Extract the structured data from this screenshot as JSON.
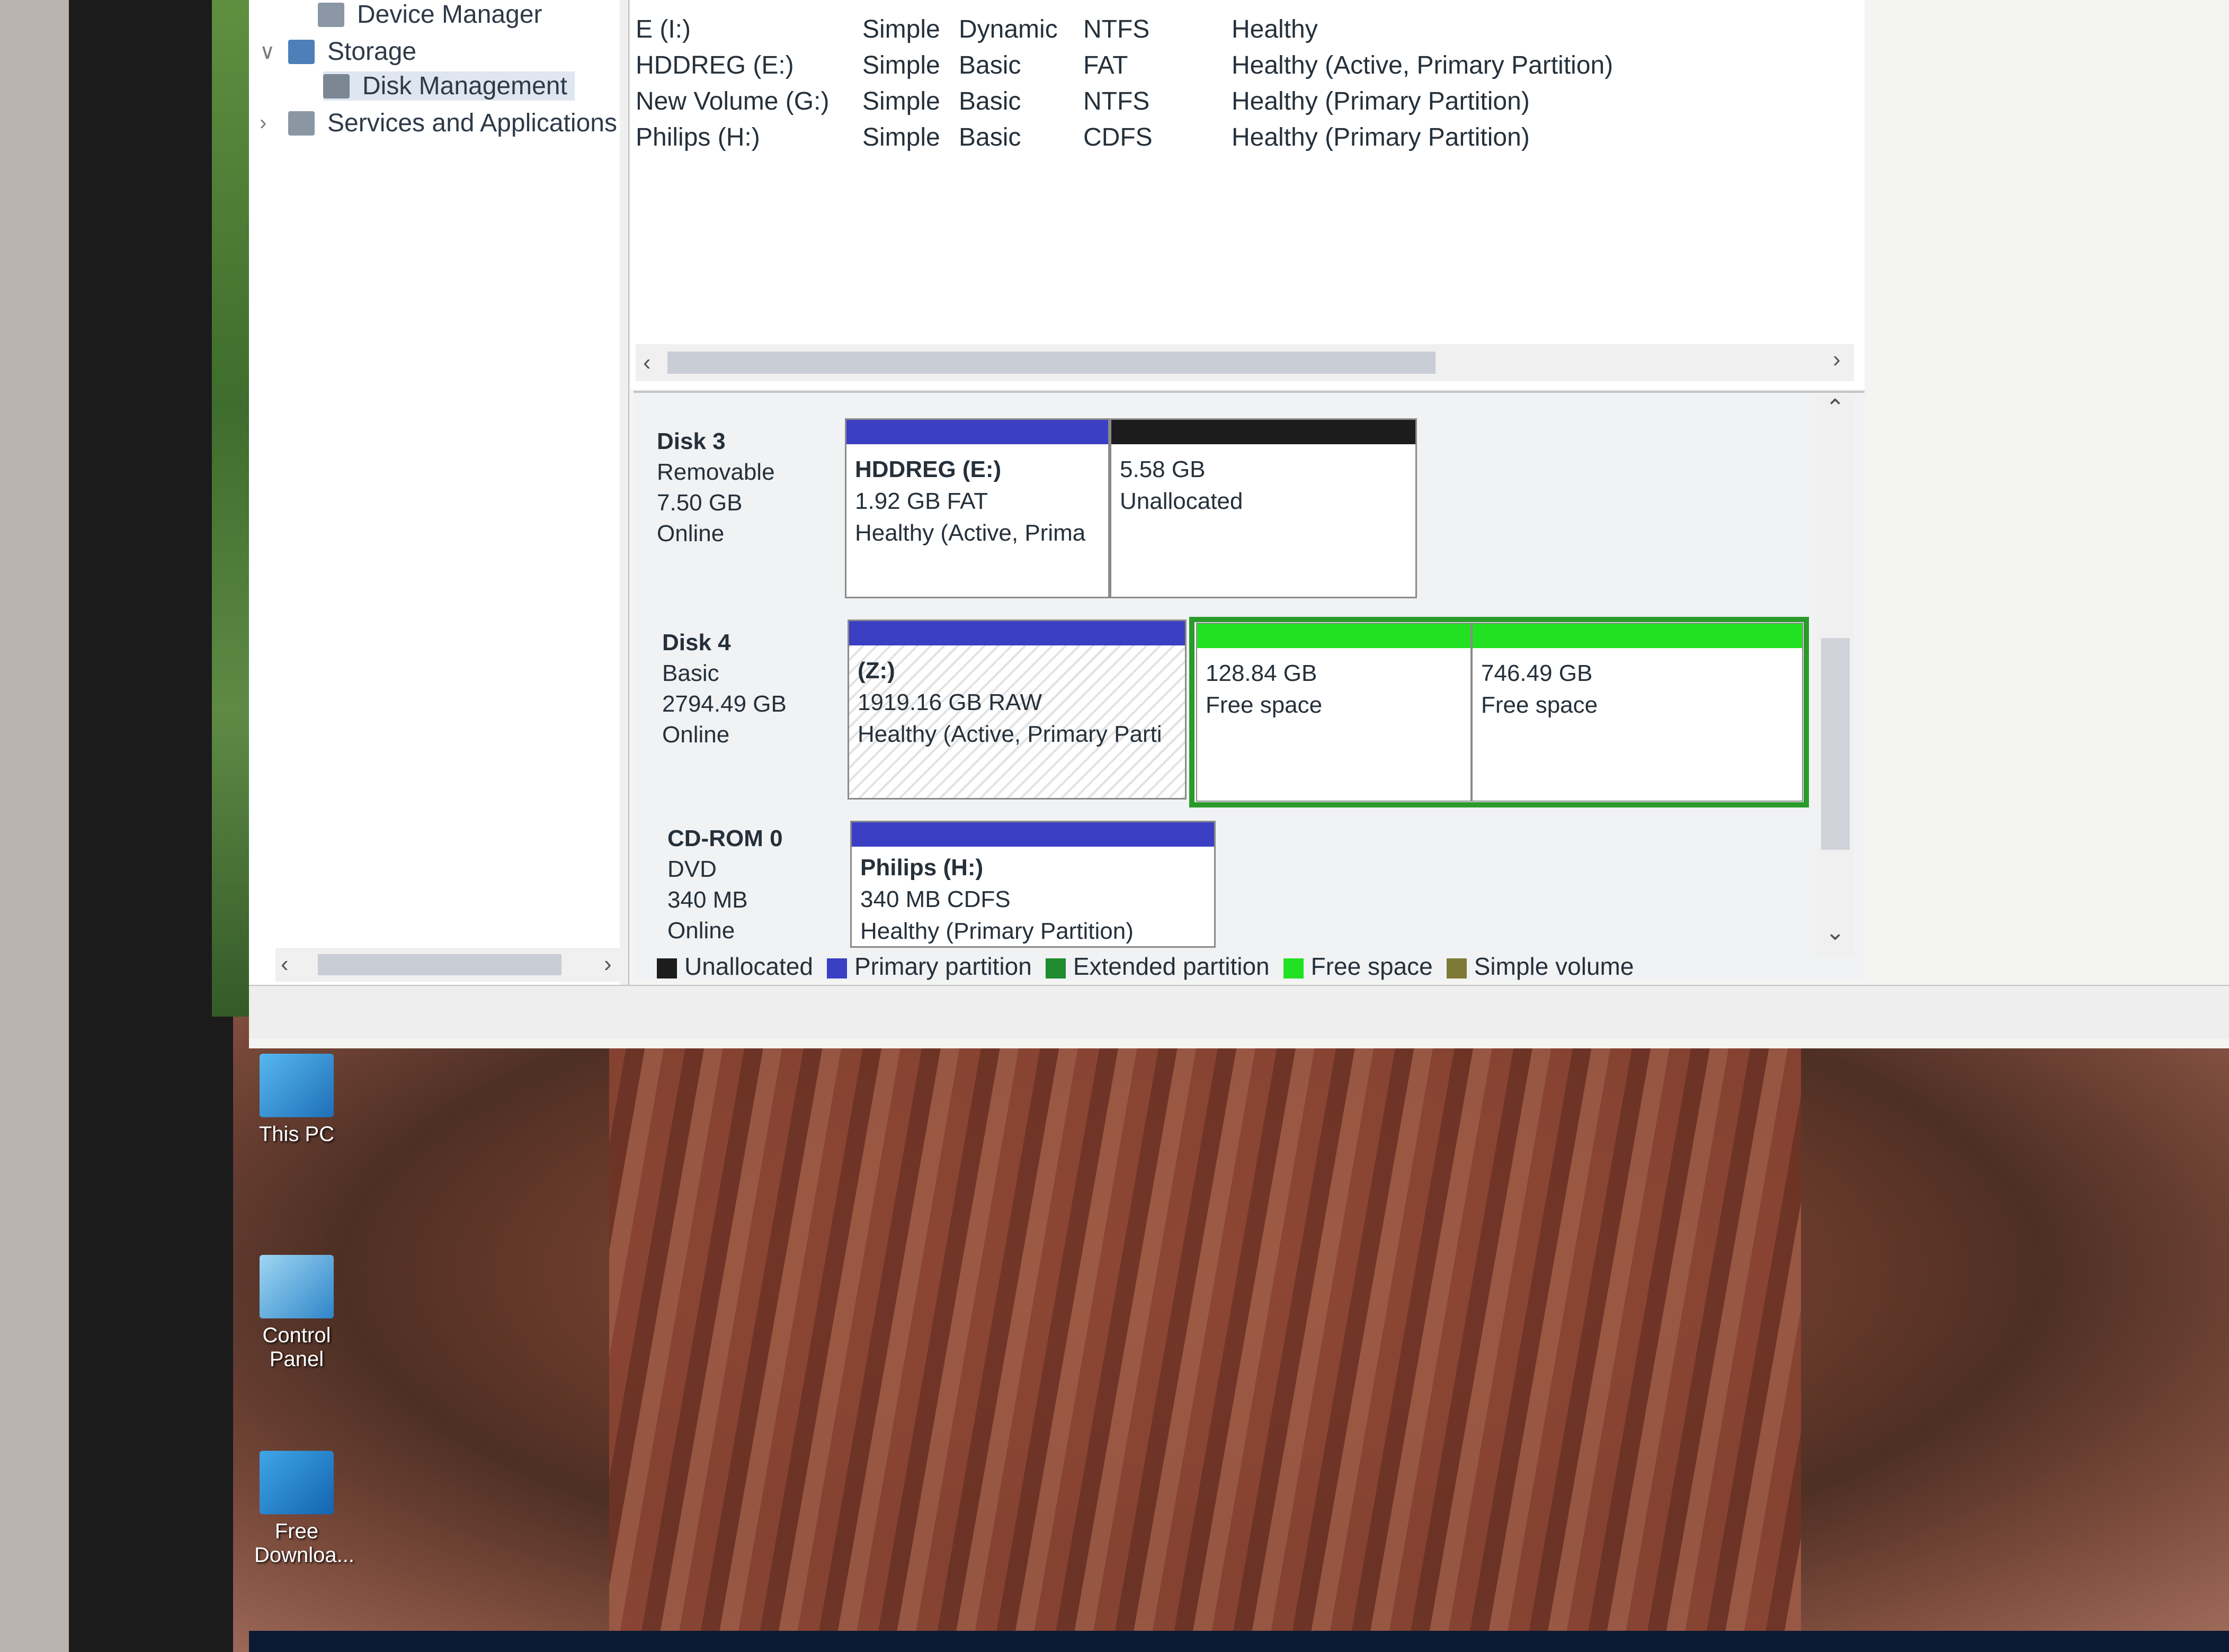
{
  "nav": {
    "items": [
      {
        "label": "Device Manager"
      },
      {
        "label": "Storage"
      },
      {
        "label": "Disk Management"
      },
      {
        "label": "Services and Applications"
      }
    ]
  },
  "volumes": [
    {
      "name": "E (I:)",
      "layout": "Simple",
      "type": "Dynamic",
      "fs": "NTFS",
      "status": "Healthy"
    },
    {
      "name": "HDDREG (E:)",
      "layout": "Simple",
      "type": "Basic",
      "fs": "FAT",
      "status": "Healthy (Active, Primary Partition)"
    },
    {
      "name": "New Volume (G:)",
      "layout": "Simple",
      "type": "Basic",
      "fs": "NTFS",
      "status": "Healthy (Primary Partition)"
    },
    {
      "name": "Philips (H:)",
      "layout": "Simple",
      "type": "Basic",
      "fs": "CDFS",
      "status": "Healthy (Primary Partition)"
    }
  ],
  "disks": [
    {
      "name": "Disk 3",
      "kind": "Removable",
      "size": "7.50 GB",
      "state": "Online",
      "partitions": [
        {
          "title": "HDDREG (E:)",
          "line1": "1.92 GB FAT",
          "line2": "Healthy (Active, Prima"
        },
        {
          "title": "",
          "line1": "5.58 GB",
          "line2": "Unallocated"
        }
      ]
    },
    {
      "name": "Disk 4",
      "kind": "Basic",
      "size": "2794.49 GB",
      "state": "Online",
      "partitions": [
        {
          "title": "(Z:)",
          "line1": "1919.16 GB RAW",
          "line2": "Healthy (Active, Primary Parti"
        },
        {
          "title": "",
          "line1": "128.84 GB",
          "line2": "Free space"
        },
        {
          "title": "",
          "line1": "746.49 GB",
          "line2": "Free space"
        }
      ]
    },
    {
      "name": "CD-ROM 0",
      "kind": "DVD",
      "size": "340 MB",
      "state": "Online",
      "partitions": [
        {
          "title": "Philips (H:)",
          "line1": "340 MB CDFS",
          "line2": "Healthy (Primary Partition)"
        }
      ]
    }
  ],
  "legend": [
    {
      "label": "Unallocated",
      "color": "#1c1c1c"
    },
    {
      "label": "Primary partition",
      "color": "#3a3fc4"
    },
    {
      "label": "Extended partition",
      "color": "#1f8a2e"
    },
    {
      "label": "Free space",
      "color": "#22e022"
    },
    {
      "label": "Simple volume",
      "color": "#7d7a35"
    }
  ],
  "colors": {
    "primary": "#3a3fc4",
    "unallocated": "#1c1c1c",
    "free": "#22e022"
  },
  "desktop_icons": [
    {
      "label": "This PC"
    },
    {
      "label": "Control Panel"
    },
    {
      "label": "Free Downloa..."
    }
  ]
}
